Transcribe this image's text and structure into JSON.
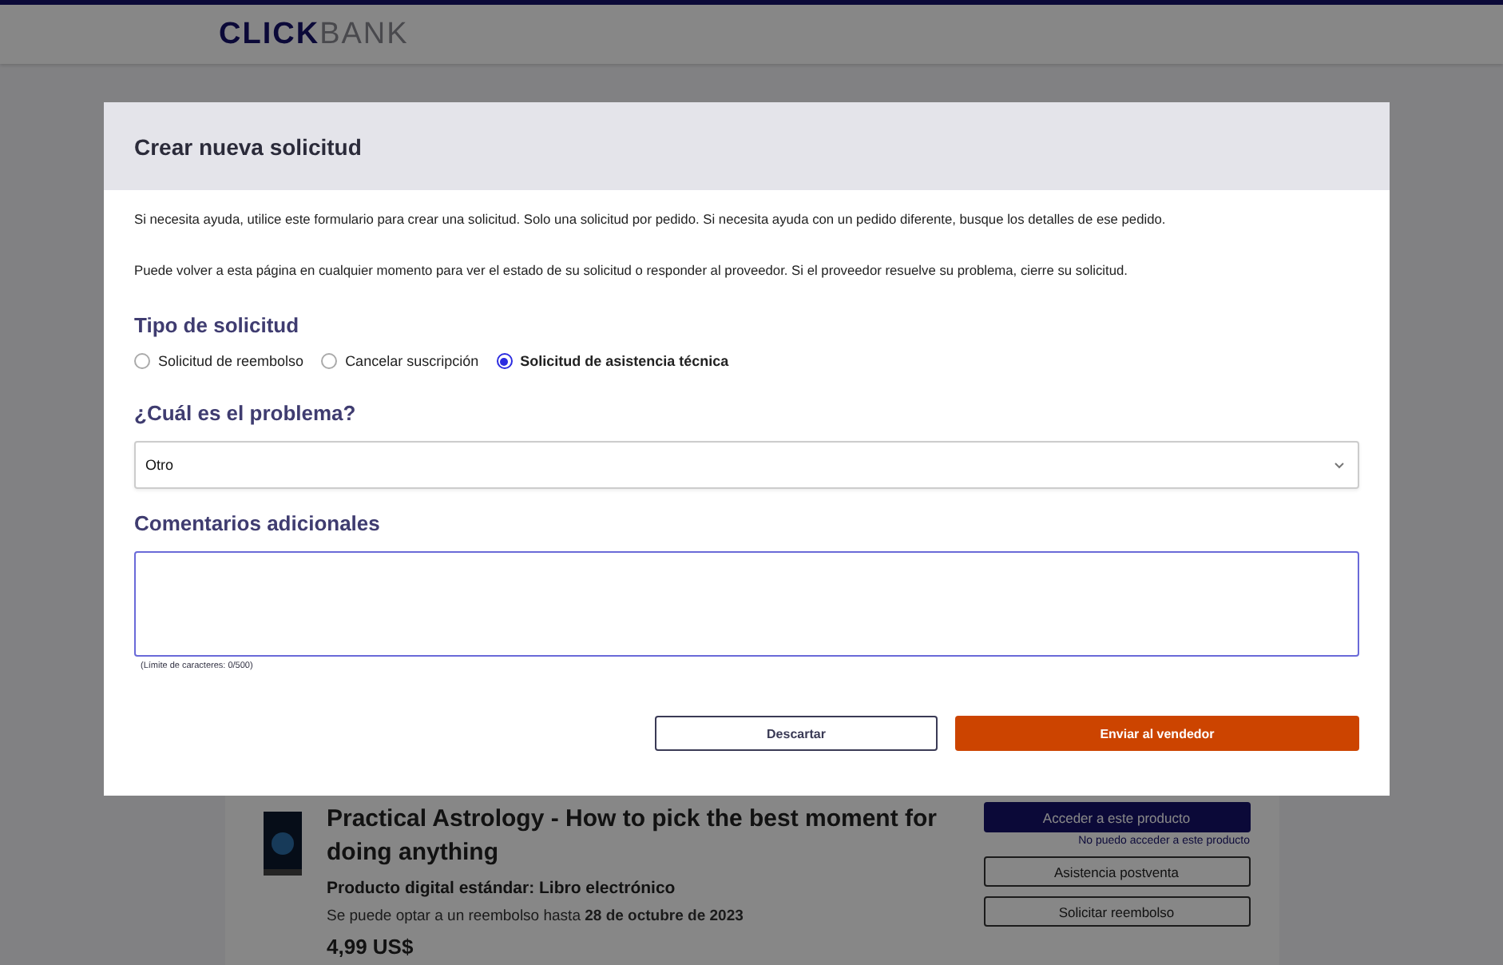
{
  "header": {
    "logo": "**CLICK**BANK"
  },
  "page": {
    "product": {
      "title": "Practical Astrology - How to pick the best moment for doing anything",
      "type": "Producto digital estándar: Libro electrónico",
      "refund_note": "Se puede optar a un reembolso hasta **28 de octubre de 2023**",
      "price": "4,99 US$",
      "actions": [
        {
          "kind": "primary",
          "label": "Acceder a este producto"
        },
        {
          "kind": "link",
          "label": "No puedo acceder a este producto"
        },
        {
          "kind": "outline",
          "label": "Asistencia postventa"
        },
        {
          "kind": "outline",
          "label": "Solicitar reembolso"
        }
      ]
    }
  },
  "dialog": {
    "title": "Crear nueva solicitud",
    "intro": [
      "Si necesita ayuda, utilice este formulario para crear una solicitud. Solo una solicitud por pedido. Si necesita ayuda con un pedido diferente, busque los detalles de ese pedido.",
      "Puede volver a esta página en cualquier momento para ver el estado de su solicitud o responder al proveedor. Si el proveedor resuelve su problema, cierre su solicitud."
    ],
    "request_type": {
      "label": "Tipo de solicitud",
      "options": [
        {
          "label": "Solicitud de reembolso",
          "selected": false
        },
        {
          "label": "Cancelar suscripción",
          "selected": false
        },
        {
          "label": "Solicitud de asistencia técnica",
          "selected": true
        }
      ]
    },
    "problem": {
      "label": "¿Cuál es el problema?",
      "value": "Otro"
    },
    "comments": {
      "label": "Comentarios adicionales",
      "limit": "(Límite de caracteres: 0/500)"
    },
    "buttons": [
      {
        "kind": "secondary",
        "label": "Descartar"
      },
      {
        "kind": "primary",
        "label": "Enviar al vendedor"
      }
    ]
  }
}
